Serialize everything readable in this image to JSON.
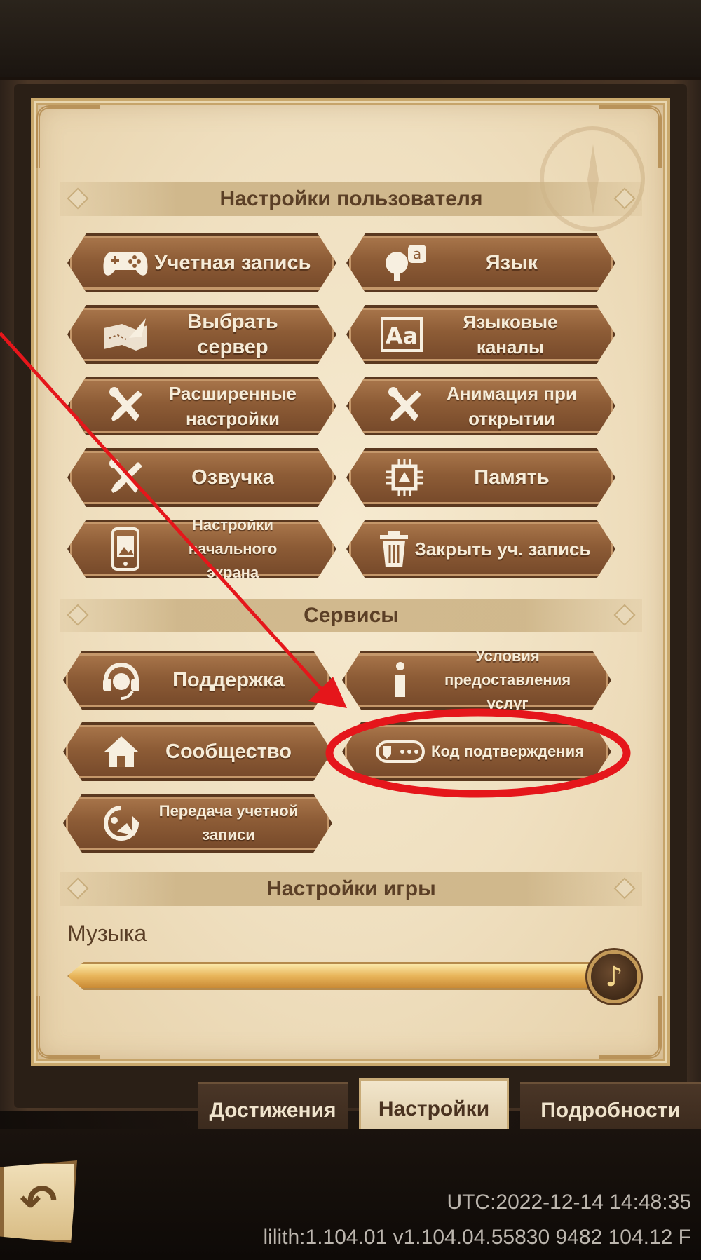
{
  "sections": {
    "user_settings": "Настройки пользователя",
    "services": "Сервисы",
    "game_settings": "Настройки игры"
  },
  "user_buttons": {
    "account": {
      "label": "Учетная запись",
      "icon": "gamepad-icon"
    },
    "language": {
      "label": "Язык",
      "icon": "language-icon"
    },
    "select_server": {
      "label": "Выбрать сервер",
      "icon": "map-quill-icon"
    },
    "language_channels": {
      "label": "Языковые каналы",
      "icon": "aa-icon"
    },
    "advanced_settings": {
      "label": "Расширенные\nнастройки",
      "icon": "tools-icon"
    },
    "opening_animation": {
      "label": "Анимация при\nоткрытии",
      "icon": "tools-icon"
    },
    "voice": {
      "label": "Озвучка",
      "icon": "tools-icon"
    },
    "memory": {
      "label": "Память",
      "icon": "chip-icon"
    },
    "home_screen_settings": {
      "label": "Настройки начального\nэкрана",
      "icon": "phone-image-icon"
    },
    "close_account": {
      "label": "Закрыть уч. запись",
      "icon": "trash-icon"
    }
  },
  "service_buttons": {
    "support": {
      "label": "Поддержка",
      "icon": "headset-icon"
    },
    "terms": {
      "label": "Условия\nпредоставления услуг",
      "icon": "info-icon"
    },
    "community": {
      "label": "Сообщество",
      "icon": "home-icon"
    },
    "verification_code": {
      "label": "Код подтверждения",
      "icon": "key-icon"
    },
    "account_transfer": {
      "label": "Передача учетной\nзаписи",
      "icon": "transfer-icon"
    }
  },
  "game_settings": {
    "music_label": "Музыка",
    "music_level": 0.95
  },
  "tabs": [
    {
      "label": "Достижения",
      "active": false
    },
    {
      "label": "Настройки",
      "active": true
    },
    {
      "label": "Подробности",
      "active": false
    }
  ],
  "footer": {
    "utc": "UTC:2022-12-14 14:48:35",
    "version": "lilith:1.104.01  v1.104.04.55830 9482 104.12 F"
  },
  "colors": {
    "annotation": "#e5161b",
    "button_wood": "#8d5c36",
    "parchment": "#f6ead0"
  }
}
